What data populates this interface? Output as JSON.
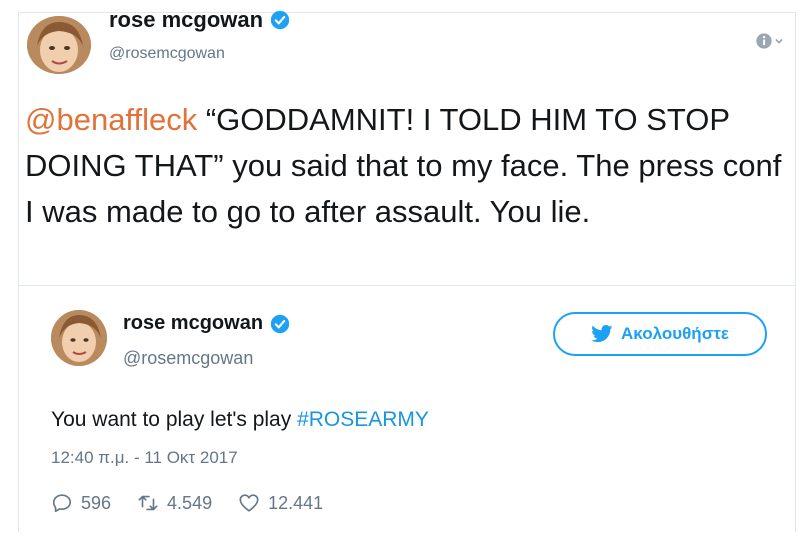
{
  "main_tweet": {
    "author_name": "rose mcgowan",
    "author_handle": "@rosemcgowan",
    "mention": "@benaffleck",
    "text": " “GODDAMNIT! I TOLD HIM TO STOP DOING THAT” you said that to my face. The press conf I was made to go to after assault. You lie."
  },
  "quoted_tweet": {
    "author_name": "rose mcgowan",
    "author_handle": "@rosemcgowan",
    "follow_label": "Ακολουθήστε",
    "text": "You want to play let's play ",
    "hashtag": "#ROSEARMY",
    "timestamp": "12:40 π.μ. - 11 Οκτ 2017",
    "replies": "596",
    "retweets": "4.549",
    "likes": "12.441"
  },
  "colors": {
    "mention": "#e0723a",
    "hashtag": "#1b95e0",
    "twitter_blue": "#1da1f2",
    "muted": "#657786"
  },
  "icons": [
    "verified-badge-icon",
    "info-icon",
    "twitter-bird-icon",
    "reply-icon",
    "retweet-icon",
    "like-icon"
  ]
}
